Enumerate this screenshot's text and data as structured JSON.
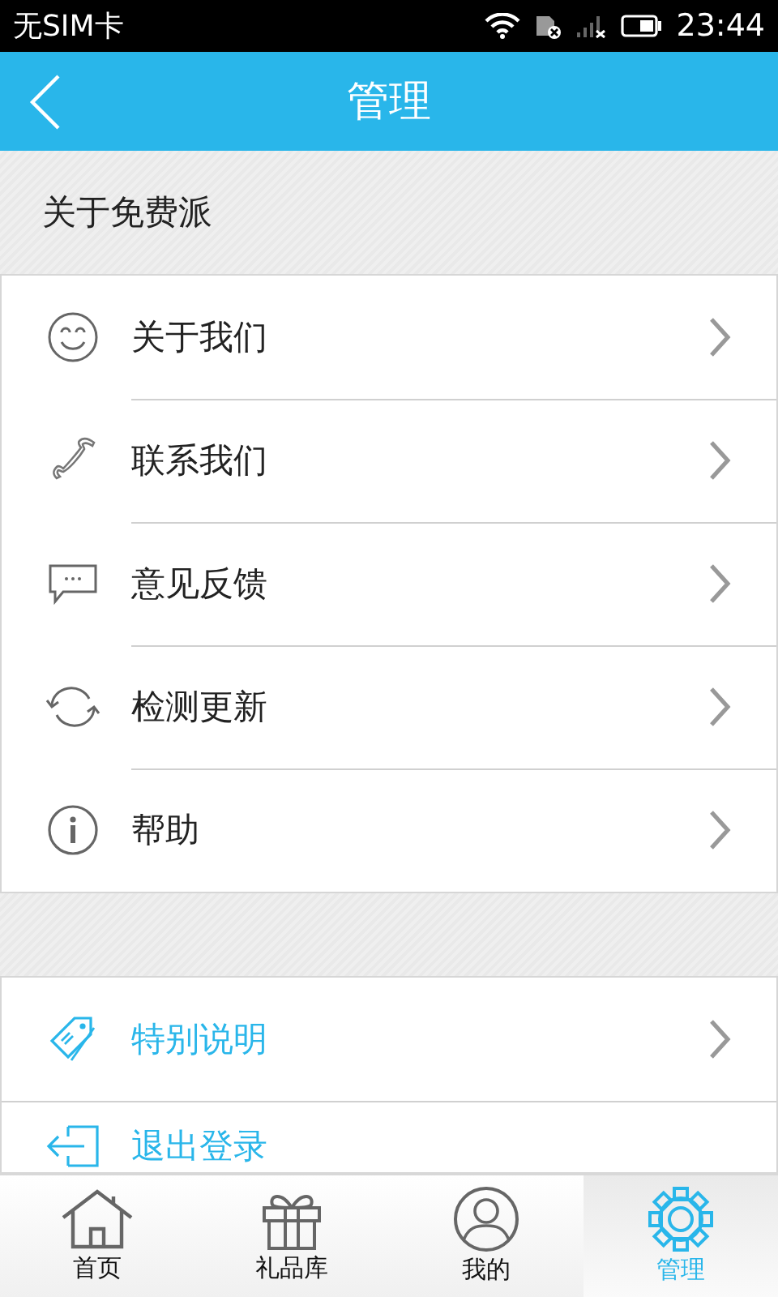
{
  "status_bar": {
    "carrier": "无SIM卡",
    "time": "23:44"
  },
  "header": {
    "title": "管理"
  },
  "section_title": "关于免费派",
  "groups": [
    {
      "items": [
        {
          "label": "关于我们",
          "kind": "normal",
          "arrow": true
        },
        {
          "label": "联系我们",
          "kind": "normal",
          "arrow": true
        },
        {
          "label": "意见反馈",
          "kind": "normal",
          "arrow": true
        },
        {
          "label": "检测更新",
          "kind": "normal",
          "arrow": true
        },
        {
          "label": "帮助",
          "kind": "normal",
          "arrow": true
        }
      ]
    },
    {
      "items": [
        {
          "label": "特别说明",
          "kind": "accent",
          "arrow": true
        },
        {
          "label": "退出登录",
          "kind": "accent",
          "arrow": false
        }
      ]
    }
  ],
  "tabs": [
    {
      "label": "首页",
      "selected": false
    },
    {
      "label": "礼品库",
      "selected": false
    },
    {
      "label": "我的",
      "selected": false
    },
    {
      "label": "管理",
      "selected": true
    }
  ]
}
